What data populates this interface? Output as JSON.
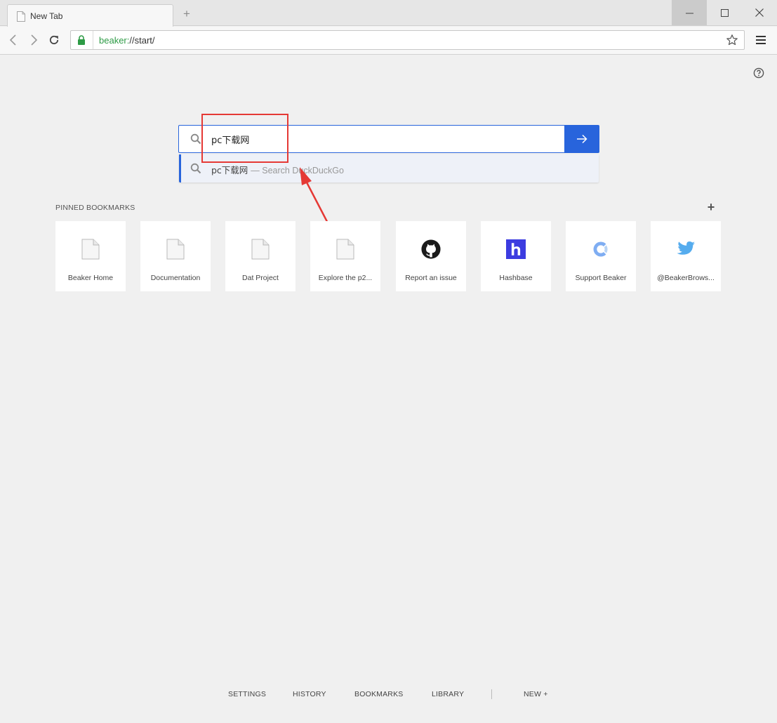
{
  "tab": {
    "title": "New Tab",
    "new_tab_label": "+"
  },
  "toolbar": {
    "url_scheme": "beaker:",
    "url_rest": "//start/"
  },
  "search": {
    "value": "pc下载网",
    "suggestion_query": "pc下载网",
    "suggestion_hint": "— Search DuckDuckGo"
  },
  "pinned": {
    "header": "PINNED BOOKMARKS",
    "add_label": "+",
    "items": [
      {
        "label": "Beaker Home",
        "icon": "page-icon"
      },
      {
        "label": "Documentation",
        "icon": "page-icon"
      },
      {
        "label": "Dat Project",
        "icon": "page-icon"
      },
      {
        "label": "Explore the p2...",
        "icon": "page-icon"
      },
      {
        "label": "Report an issue",
        "icon": "github-icon"
      },
      {
        "label": "Hashbase",
        "icon": "hashbase-icon"
      },
      {
        "label": "Support Beaker",
        "icon": "opencollective-icon"
      },
      {
        "label": "@BeakerBrows...",
        "icon": "twitter-icon"
      }
    ]
  },
  "footer": {
    "links": [
      "SETTINGS",
      "HISTORY",
      "BOOKMARKS",
      "LIBRARY",
      "NEW +"
    ]
  },
  "colors": {
    "accent": "#2864dc",
    "secure_green": "#2e9b46",
    "annotation_red": "#e53935",
    "hashbase_purple": "#3c3ce0",
    "twitter_blue": "#55acee"
  }
}
